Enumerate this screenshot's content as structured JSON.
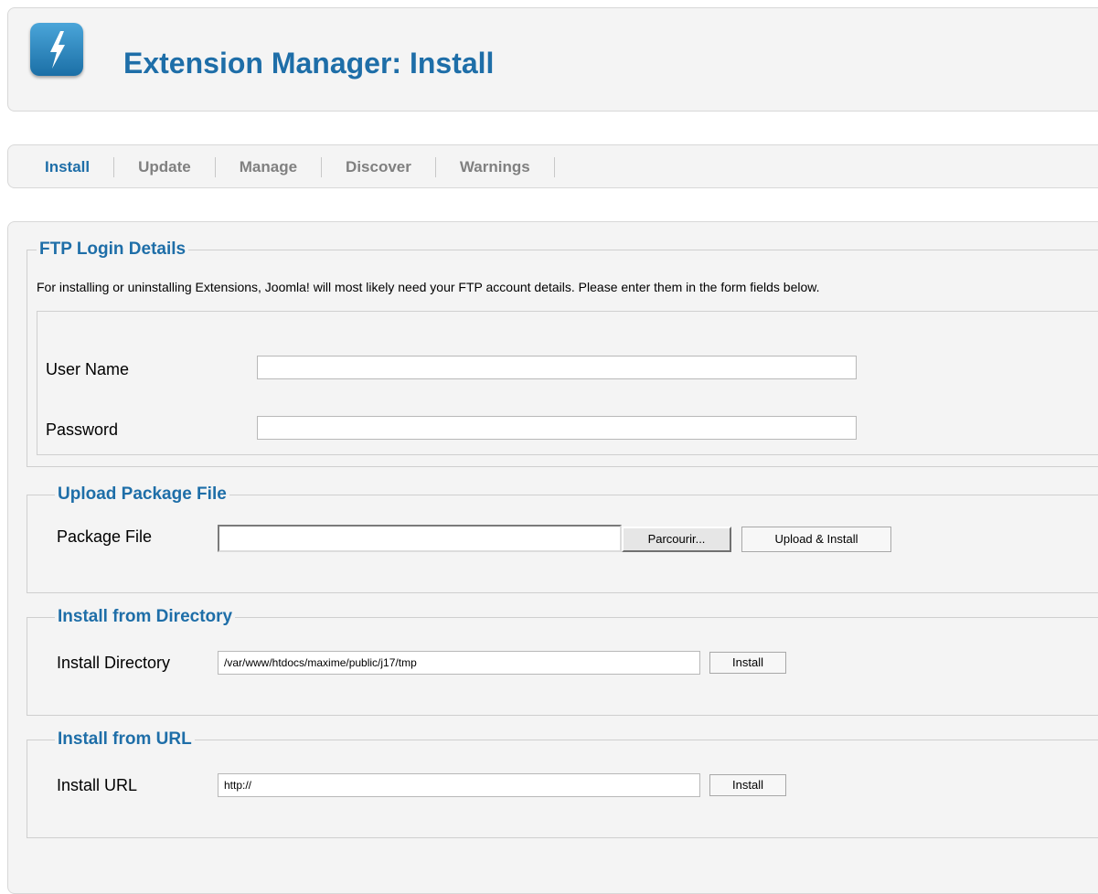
{
  "header": {
    "title": "Extension Manager: Install",
    "icon": "lightning-bolt-icon",
    "accent_color": "#1e6ea8"
  },
  "tabs": [
    {
      "label": "Install",
      "active": true
    },
    {
      "label": "Update",
      "active": false
    },
    {
      "label": "Manage",
      "active": false
    },
    {
      "label": "Discover",
      "active": false
    },
    {
      "label": "Warnings",
      "active": false
    }
  ],
  "ftp": {
    "legend": "FTP Login Details",
    "description": "For installing or uninstalling Extensions, Joomla! will most likely need your FTP account details. Please enter them in the form fields below.",
    "username_label": "User Name",
    "username_value": "",
    "password_label": "Password",
    "password_value": ""
  },
  "upload": {
    "legend": "Upload Package File",
    "label": "Package File",
    "file_value": "",
    "browse_label": "Parcourir...",
    "submit_label": "Upload & Install"
  },
  "directory": {
    "legend": "Install from Directory",
    "label": "Install Directory",
    "value": "/var/www/htdocs/maxime/public/j17/tmp",
    "submit_label": "Install"
  },
  "url": {
    "legend": "Install from URL",
    "label": "Install URL",
    "value": "http://",
    "submit_label": "Install"
  }
}
